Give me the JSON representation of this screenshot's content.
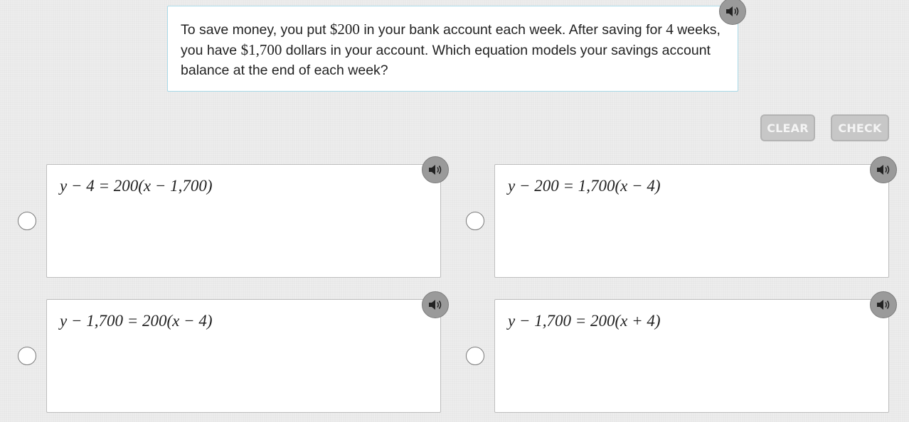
{
  "question": {
    "parts": [
      {
        "text": "To save money, you put ",
        "math": false
      },
      {
        "text": "$200",
        "math": true
      },
      {
        "text": " in your bank account each week. After saving for ",
        "math": false
      },
      {
        "text": "4",
        "math": true
      },
      {
        "text": " weeks, you have ",
        "math": false
      },
      {
        "text": "$1,700",
        "math": true
      },
      {
        "text": " dollars in your account. Which equation models your savings account balance at the end of each week?",
        "math": false
      }
    ],
    "audio_icon": "speaker-icon"
  },
  "controls": {
    "clear_label": "CLEAR",
    "check_label": "CHECK"
  },
  "options": [
    {
      "label": "y − 4 = 200(x − 1,700)",
      "selected": false
    },
    {
      "label": "y − 200 = 1,700(x − 4)",
      "selected": false
    },
    {
      "label": "y − 1,700 = 200(x − 4)",
      "selected": false
    },
    {
      "label": "y − 1,700 = 200(x + 4)",
      "selected": false
    }
  ],
  "colors": {
    "background": "#e8e8e8",
    "question_border": "#a9d9e8",
    "button_disabled": "#c7c7c7",
    "audio_button": "#9a9a9a"
  }
}
